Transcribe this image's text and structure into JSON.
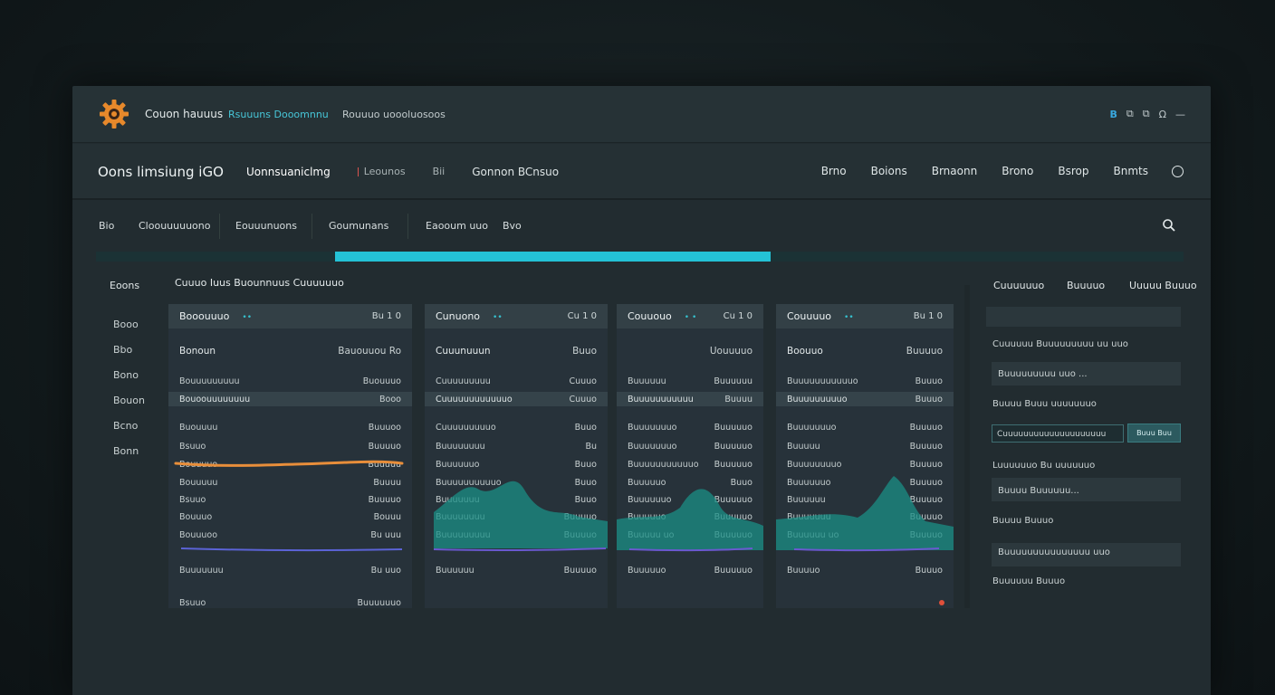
{
  "titlebar": {
    "app_title": "Couon hauuus",
    "link": "Rsuuuns Dooomnnu",
    "subtitle": "Rouuuo uoooluosoos",
    "icons": [
      "B",
      "⧉",
      "⧉",
      "Ω",
      "—"
    ]
  },
  "nav": {
    "title": "Oons limsiung iGO",
    "left": [
      "Uonnsuaniclmg",
      "Leounos",
      "Bii",
      "Gonnon BCnsuo"
    ],
    "right": [
      "Brno",
      "Boions",
      "Brnaonn",
      "Brono",
      "Bsrop",
      "Bnmts"
    ]
  },
  "tabs": [
    "Bio",
    "Cloouuuuuono",
    "Eouuunuons",
    "Goumunans",
    "Eaooum uuo",
    "Bvo"
  ],
  "progress": {
    "fraction": 0.62,
    "color": "#24c2d6"
  },
  "sidebar": {
    "heading": "Eoons",
    "items": [
      "Booo",
      "Bbo",
      "Bono",
      "Bouon",
      "Bcno",
      "Bonn"
    ]
  },
  "section_heading": "Cuuuo Iuus Buounnuus Cuuuuuuo",
  "panels": [
    {
      "title": "Booouuuo",
      "dots": "••",
      "head_value": "Bu 1 0",
      "rows": [
        {
          "label": "Bonoun",
          "value": "Bauouuou Ro",
          "style": "bold"
        },
        {
          "label": "Bouuuuuuuuu",
          "value": "Buouuuo",
          "style": ""
        },
        {
          "label": "Bouoouuuuuuuu",
          "value": "Booo",
          "style": "hl"
        },
        {
          "label": "Buouuuu",
          "value": "Buuuoo",
          "style": ""
        },
        {
          "label": "Bsuuo",
          "value": "Buuuuo",
          "style": ""
        },
        {
          "label": "Bouuuuo",
          "value": "Buuuuu",
          "style": ""
        },
        {
          "label": "Bouuuuu",
          "value": "Buuuu",
          "style": ""
        },
        {
          "label": "Bsuuo",
          "value": "Buuuuo",
          "style": ""
        },
        {
          "label": "Bouuuo",
          "value": "Bouuu",
          "style": ""
        },
        {
          "label": "Bouuuoo",
          "value": "Bu uuu",
          "style": ""
        },
        {
          "label": "Buuuuuuu",
          "value": "Bu uuo",
          "style": ""
        },
        {
          "label": "Bsuuo",
          "value": "Buuuuuuo",
          "style": ""
        }
      ]
    },
    {
      "title": "Cunuono",
      "dots": "••",
      "head_value": "Cu 1 0",
      "rows": [
        {
          "label": "Cuuunuuun",
          "value": "Buuo",
          "style": "bold"
        },
        {
          "label": "Cuuuuuuuuu",
          "value": "Cuuuo",
          "style": ""
        },
        {
          "label": "Cuuuuuuuuuuuuo",
          "value": "Cuuuo",
          "style": "hl"
        },
        {
          "label": "Cuuuuuuuuuo",
          "value": "Buuo",
          "style": ""
        },
        {
          "label": "Buuuuuuuu",
          "value": "Bu",
          "style": ""
        },
        {
          "label": "Buuuuuuo",
          "value": "Buuo",
          "style": ""
        },
        {
          "label": "Buuuuuuuuuuo",
          "value": "Buuo",
          "style": ""
        },
        {
          "label": "Buuuuuuu",
          "value": "Buuo",
          "style": ""
        },
        {
          "label": "Buuuuuuuu",
          "value": "Buuuuo",
          "style": ""
        },
        {
          "label": "Buuuuuuuuu",
          "value": "Buuuuo",
          "style": ""
        },
        {
          "label": "Buuuuuu",
          "value": "Buuuuo",
          "style": ""
        }
      ]
    },
    {
      "title": "Couuouo",
      "dots": "• •",
      "head_value": "Cu 1 0",
      "rows": [
        {
          "label": "",
          "value": "Uouuuuo",
          "style": "bold"
        },
        {
          "label": "Buuuuuu",
          "value": "Buuuuuu",
          "style": ""
        },
        {
          "label": "Buuuuuuuuuuu",
          "value": "Buuuu",
          "style": "hl"
        },
        {
          "label": "Buuuuuuuo",
          "value": "Buuuuuo",
          "style": ""
        },
        {
          "label": "Buuuuuuuo",
          "value": "Buuuuuo",
          "style": ""
        },
        {
          "label": "Buuuuuuuuuuuo",
          "value": "Buuuuuo",
          "style": ""
        },
        {
          "label": "Buuuuuo",
          "value": "Buuo",
          "style": ""
        },
        {
          "label": "Buuuuuuo",
          "value": "Buuuuuo",
          "style": ""
        },
        {
          "label": "Buuuuuo",
          "value": "Buuuuuo",
          "style": ""
        },
        {
          "label": "Buuuuu uo",
          "value": "Buuuuuo",
          "style": ""
        },
        {
          "label": "Buuuuuo",
          "value": "Buuuuuo",
          "style": ""
        }
      ]
    },
    {
      "title": "Couuuuo",
      "dots": "••",
      "head_value": "Bu 1 0",
      "rows": [
        {
          "label": "Boouuo",
          "value": "Buuuuo",
          "style": "bold"
        },
        {
          "label": "Buuuuuuuuuuuo",
          "value": "Buuuo",
          "style": ""
        },
        {
          "label": "Buuuuuuuuuo",
          "value": "Buuuo",
          "style": "hl"
        },
        {
          "label": "Buuuuuuuo",
          "value": "Buuuuo",
          "style": ""
        },
        {
          "label": "Buuuuu",
          "value": "Buuuuo",
          "style": ""
        },
        {
          "label": "Buuuuuuuuo",
          "value": "Buuuuo",
          "style": ""
        },
        {
          "label": "Buuuuuuo",
          "value": "Buuuuo",
          "style": ""
        },
        {
          "label": "Buuuuuu",
          "value": "Buuuuo",
          "style": ""
        },
        {
          "label": "Buuuuuuu",
          "value": "Buuuuo",
          "style": ""
        },
        {
          "label": "Buuuuuu uo",
          "value": "Buuuuo",
          "style": ""
        },
        {
          "label": "Buuuuo",
          "value": "Buuuo",
          "style": ""
        }
      ]
    }
  ],
  "right_sidebar": {
    "headings": [
      "Cuuuuuuo",
      "Buuuuo",
      "Uuuuu Buuuo"
    ],
    "items": [
      "Cuuuuuu Buuuuuuuuu uu uuo",
      "Buuuuuuuuu uuo ...",
      "Buuuu Buuu uuuuuuuo",
      "Buuuuuuuuuuuuuuuuuuuo",
      "Luuuuuuo Bu uuuuuuo",
      "Buuuu Buuuuuu...",
      "Buuuu Buuuo",
      "Buuuuuuuuuuuuuuu  uuo",
      "Buuuuuu Buuuo"
    ],
    "input_value": "Cuuuuuuuuuuuuuuuuuuuu",
    "button_label": "Buuu Buu"
  }
}
